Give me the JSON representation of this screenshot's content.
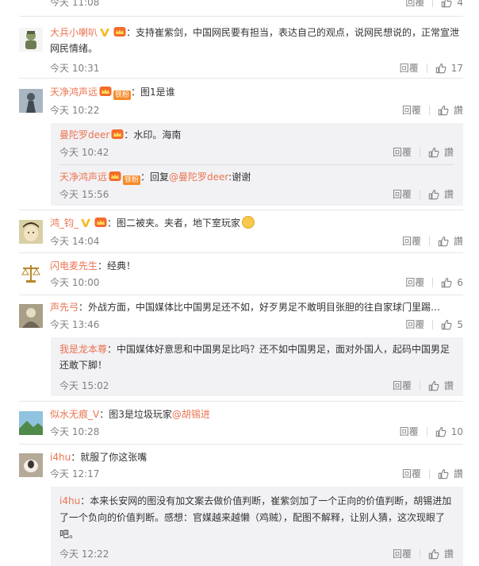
{
  "ui": {
    "reply_label": "回覆",
    "like_label_zh": "讚"
  },
  "comments": [
    {
      "id": "c0",
      "time": "今天 11:08",
      "likes": "4"
    },
    {
      "id": "c1",
      "user": "大兵小喇叭",
      "text": "：支持崔紫剑，中国网民要有担当，表达自己的观点，说网民想说的，正常宣泄网民情绪。",
      "time": "今天 10:31",
      "likes": "17"
    },
    {
      "id": "c2",
      "user": "天净鸿声远",
      "fan": "铁粉",
      "text": "：图1是谁",
      "time": "今天 10:22",
      "likes": "讚",
      "replies": [
        {
          "user": "曼陀罗deer",
          "text": "：水印。海南",
          "time": "今天 10:42",
          "likes": "讚"
        },
        {
          "user": "天净鸿声远",
          "fan": "铁粉",
          "text_pre": "：回复",
          "mention": "@曼陀罗deer",
          "text_post": ":谢谢",
          "time": "今天 15:56",
          "likes": "讚"
        }
      ]
    },
    {
      "id": "c3",
      "user": "鸿_钧_",
      "text": "：图二被夹。夹者，地下室玩家",
      "time": "今天 14:04",
      "likes": "讚"
    },
    {
      "id": "c4",
      "user": "闪电麦先生",
      "text": "：经典！",
      "time": "今天 10:00",
      "likes": "6"
    },
    {
      "id": "c5",
      "user": "声先弓",
      "text": "：外战方面，中国媒体比中国男足还不如，好歹男足不敢明目张胆的往自家球门里踢…",
      "time": "今天 13:46",
      "likes": "5",
      "replies": [
        {
          "user": "我是龙本尊",
          "text": "：中国媒体好意思和中国男足比吗？还不如中国男足，面对外国人，起码中国男足还敢下脚！",
          "time": "今天 15:02",
          "likes": "讚"
        }
      ]
    },
    {
      "id": "c6",
      "user": "似水无痕_V",
      "text": "：图3是垃圾玩家",
      "mention": "@胡锡进",
      "time": "今天 10:28",
      "likes": "10"
    },
    {
      "id": "c7",
      "user": "i4hu",
      "text": "：就服了你这张嘴",
      "time": "今天 12:17",
      "likes": "讚",
      "replies": [
        {
          "user": "i4hu",
          "text": "：本来长安网的图没有加文案去做价值判断，崔紫剑加了一个正向的价值判断，胡锡进加了一个负向的价值判断。感想：官媒越来越懒（鸡贼），配图不解释，让别人猜，这次现眼了吧。",
          "time": "今天 12:22",
          "likes": "讚"
        }
      ]
    }
  ]
}
